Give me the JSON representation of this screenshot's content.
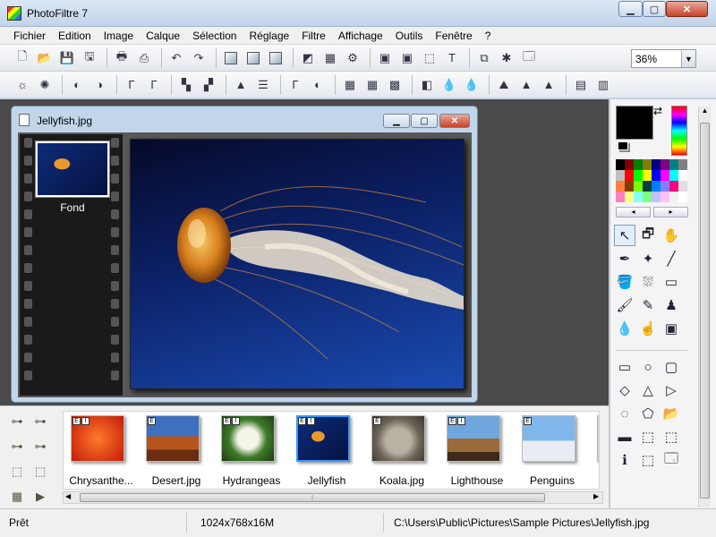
{
  "app": {
    "title": "PhotoFiltre 7"
  },
  "menu": [
    "Fichier",
    "Edition",
    "Image",
    "Calque",
    "Sélection",
    "Réglage",
    "Filtre",
    "Affichage",
    "Outils",
    "Fenêtre",
    "?"
  ],
  "toolbar": {
    "zoom_value": "36%"
  },
  "document": {
    "title": "Jellyfish.jpg",
    "layer_name": "Fond"
  },
  "browser": {
    "thumbnails": [
      {
        "caption": "Chrysanthe...",
        "badges": [
          "E",
          "I"
        ]
      },
      {
        "caption": "Desert.jpg",
        "badges": [
          "E"
        ]
      },
      {
        "caption": "Hydrangeas",
        "badges": [
          "E",
          "I"
        ]
      },
      {
        "caption": "Jellyfish",
        "badges": [
          "E",
          "I"
        ]
      },
      {
        "caption": "Koala.jpg",
        "badges": [
          "E"
        ]
      },
      {
        "caption": "Lighthouse",
        "badges": [
          "E",
          "I"
        ]
      },
      {
        "caption": "Penguins",
        "badges": [
          "E"
        ]
      }
    ]
  },
  "status": {
    "ready": "Prêt",
    "image_info": "1024x768x16M",
    "path": "C:\\Users\\Public\\Pictures\\Sample Pictures\\Jellyfish.jpg"
  },
  "colors": {
    "foreground": "#000000",
    "accent": "#c7432a"
  }
}
